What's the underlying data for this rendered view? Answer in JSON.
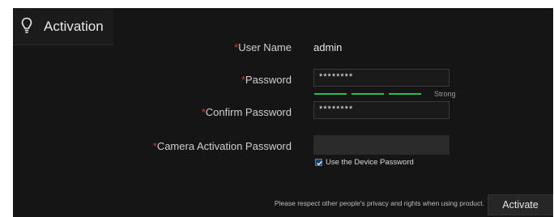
{
  "header": {
    "title": "Activation",
    "icon": "lightbulb-icon"
  },
  "form": {
    "required_mark": "*",
    "user_name": {
      "label": "User Name",
      "value": "admin"
    },
    "password": {
      "label": "Password",
      "value": "********",
      "strength": "Strong"
    },
    "confirm_password": {
      "label": "Confirm Password",
      "value": "********"
    },
    "camera_activation_password": {
      "label": "Camera Activation Password",
      "value": ""
    },
    "use_device_password": {
      "label": "Use the Device Password",
      "checked": true
    }
  },
  "footer": {
    "notice": "Please respect other people's privacy and rights when using product.",
    "activate_label": "Activate"
  },
  "colors": {
    "background": "#151515",
    "required": "#e0332f",
    "strength_bar": "#2fbf44",
    "checkbox": "#3d7bd9"
  }
}
